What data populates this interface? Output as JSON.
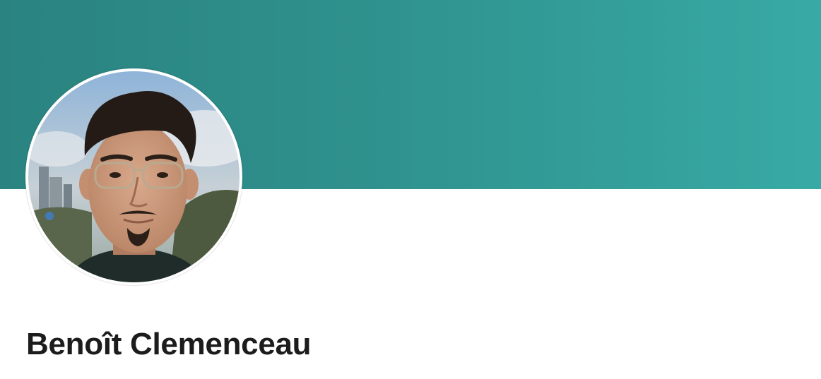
{
  "profile": {
    "name": "Benoît Clemenceau",
    "avatar_icon": "profile-photo-icon"
  },
  "colors": {
    "banner_start": "#2a8380",
    "banner_end": "#38aaa5",
    "name_text": "#1c1c1c"
  }
}
